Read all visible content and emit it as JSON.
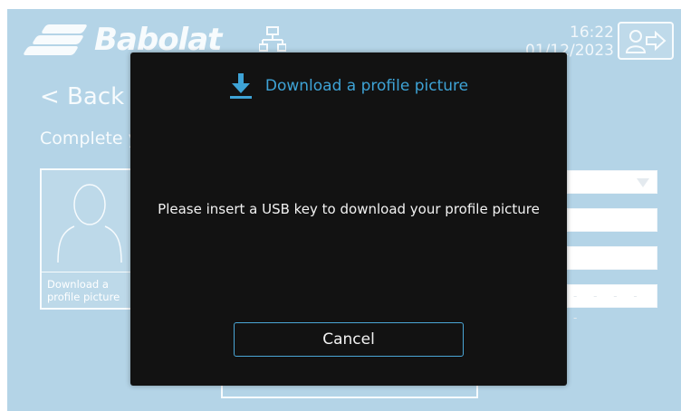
{
  "app": {
    "brand_name": "Babolat",
    "clock_time": "16:22",
    "clock_date": "01/12/2023",
    "back_label": "< Back",
    "form_heading": "Complete your profile",
    "photo_box_label": "Download a profile picture",
    "pin_placeholder": "- - - - -",
    "colors": {
      "background": "#3a8fbf",
      "accent": "#3ea3d6"
    }
  },
  "modal": {
    "title": "Download a profile picture",
    "message": "Please insert a USB key to download your profile picture",
    "cancel_label": "Cancel",
    "icon": "download-icon",
    "colors": {
      "background": "#121212",
      "title": "#3ea3d6",
      "button_border": "#4aa6d6"
    }
  }
}
